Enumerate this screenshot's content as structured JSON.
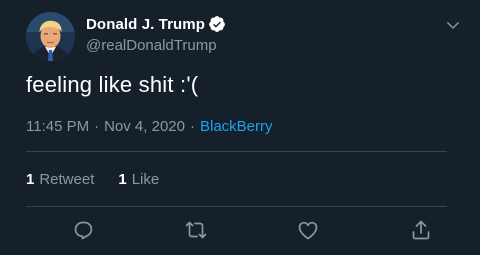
{
  "user": {
    "display_name": "Donald J. Trump",
    "handle": "@realDonaldTrump",
    "avatar": "avatar-photo",
    "verified": true
  },
  "tweet": {
    "text": "feeling like shit :'(",
    "time": "11:45 PM",
    "separator": "·",
    "date": "Nov 4, 2020",
    "source": "BlackBerry"
  },
  "stats": {
    "retweets_count": "1",
    "retweets_label": "Retweet",
    "likes_count": "1",
    "likes_label": "Like"
  },
  "icons": {
    "verified": "verified-badge-icon",
    "more": "chevron-down-icon",
    "reply": "reply-icon",
    "retweet": "retweet-icon",
    "like": "heart-icon",
    "share": "share-icon"
  },
  "colors": {
    "background": "#15202b",
    "text": "#ffffff",
    "muted": "#8899a6",
    "accent": "#1da1f2",
    "divider": "#38444d"
  }
}
